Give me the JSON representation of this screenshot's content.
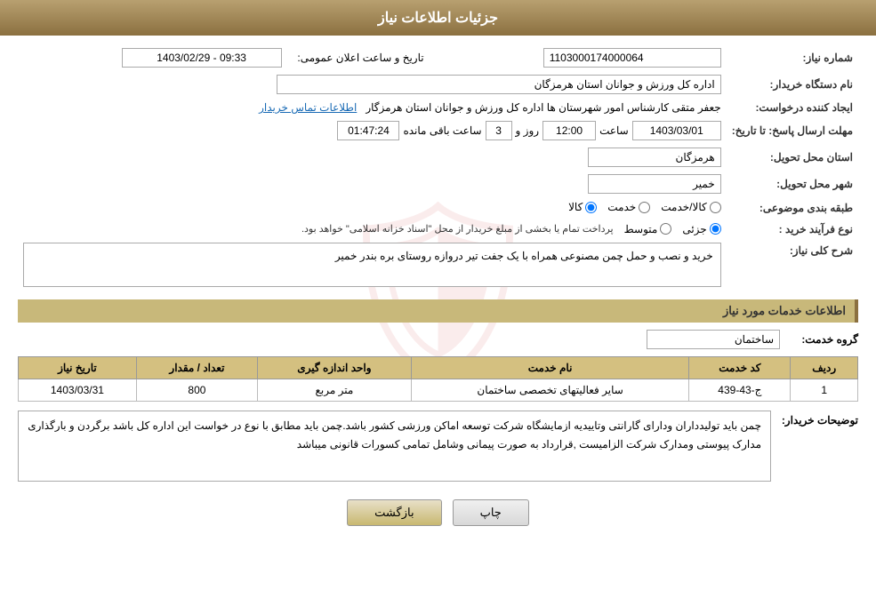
{
  "header": {
    "title": "جزئیات اطلاعات نیاز"
  },
  "fields": {
    "شماره_نیاز_label": "شماره نیاز:",
    "شماره_نیاز_value": "1103000174000064",
    "نام_دستگاه_label": "نام دستگاه خریدار:",
    "نام_دستگاه_value": "اداره کل ورزش و جوانان استان هرمزگان",
    "ایجاد_کننده_label": "ایجاد کننده درخواست:",
    "ایجاد_کننده_value": "جعفر متقی کارشناس امور شهرستان ها اداره کل ورزش و جوانان استان هرمزگار",
    "اطلاعات_تماس_link": "اطلاعات تماس خریدار",
    "تاریخ_ارسال_label": "مهلت ارسال پاسخ: تا تاریخ:",
    "تاریخ_ارسال_date": "1403/03/01",
    "تاریخ_ارسال_ساعت_label": "ساعت",
    "تاریخ_ارسال_ساعت": "12:00",
    "تاریخ_ارسال_روز_label": "روز و",
    "تاریخ_ارسال_روز": "3",
    "تاریخ_ارسال_باقیمانده_label": "ساعت باقی مانده",
    "تاریخ_ارسال_باقیمانده": "01:47:24",
    "تاریخ_اعلان_label": "تاریخ و ساعت اعلان عمومی:",
    "تاریخ_اعلان_value": "1403/02/29 - 09:33",
    "استان_تحویل_label": "استان محل تحویل:",
    "استان_تحویل_value": "هرمزگان",
    "شهر_تحویل_label": "شهر محل تحویل:",
    "شهر_تحویل_value": "خمیر",
    "طبقه_بندی_label": "طبقه بندی موضوعی:",
    "طبقه_بندی_کالا": "کالا",
    "طبقه_بندی_خدمت": "خدمت",
    "طبقه_بندی_کالاخدمت": "کالا/خدمت",
    "نوع_فرآیند_label": "نوع فرآیند خرید :",
    "نوع_فرآیند_جزئی": "جزئی",
    "نوع_فرآیند_متوسط": "متوسط",
    "نوع_فرآیند_desc": "پرداخت تمام یا بخشی از مبلغ خریدار از محل \"اسناد خزانه اسلامی\" خواهد بود.",
    "شرح_کلی_label": "شرح کلی نیاز:",
    "شرح_کلی_value": "خرید و نصب و حمل چمن مصنوعی همراه با یک جفت تیر دروازه روستای بره بندر خمیر",
    "section_خدمات": "اطلاعات خدمات مورد نیاز",
    "گروه_خدمت_label": "گروه خدمت:",
    "گروه_خدمت_value": "ساختمان",
    "table": {
      "headers": [
        "ردیف",
        "کد خدمت",
        "نام خدمت",
        "واحد اندازه گیری",
        "تعداد / مقدار",
        "تاریخ نیاز"
      ],
      "rows": [
        {
          "ردیف": "1",
          "کد_خدمت": "ج-43-439",
          "نام_خدمت": "سایر فعالیتهای تخصصی ساختمان",
          "واحد": "متر مربع",
          "تعداد": "800",
          "تاریخ": "1403/03/31"
        }
      ]
    },
    "توضیحات_label": "توضیحات خریدار:",
    "توضیحات_value": "چمن باید تولیدداران ودارای گارانتی وتاییدیه ازمایشگاه شرکت توسعه اماکن ورزشی کشور باشد.چمن باید مطابق با نوع در خواست این اداره کل باشد برگردن و بارگذاری مدارک پیوستی  ومدارک شرکت الزامیست ,قرارداد به صورت پیمانی وشامل تمامی کسورات قانونی میباشد",
    "buttons": {
      "back": "بازگشت",
      "print": "چاپ"
    }
  }
}
